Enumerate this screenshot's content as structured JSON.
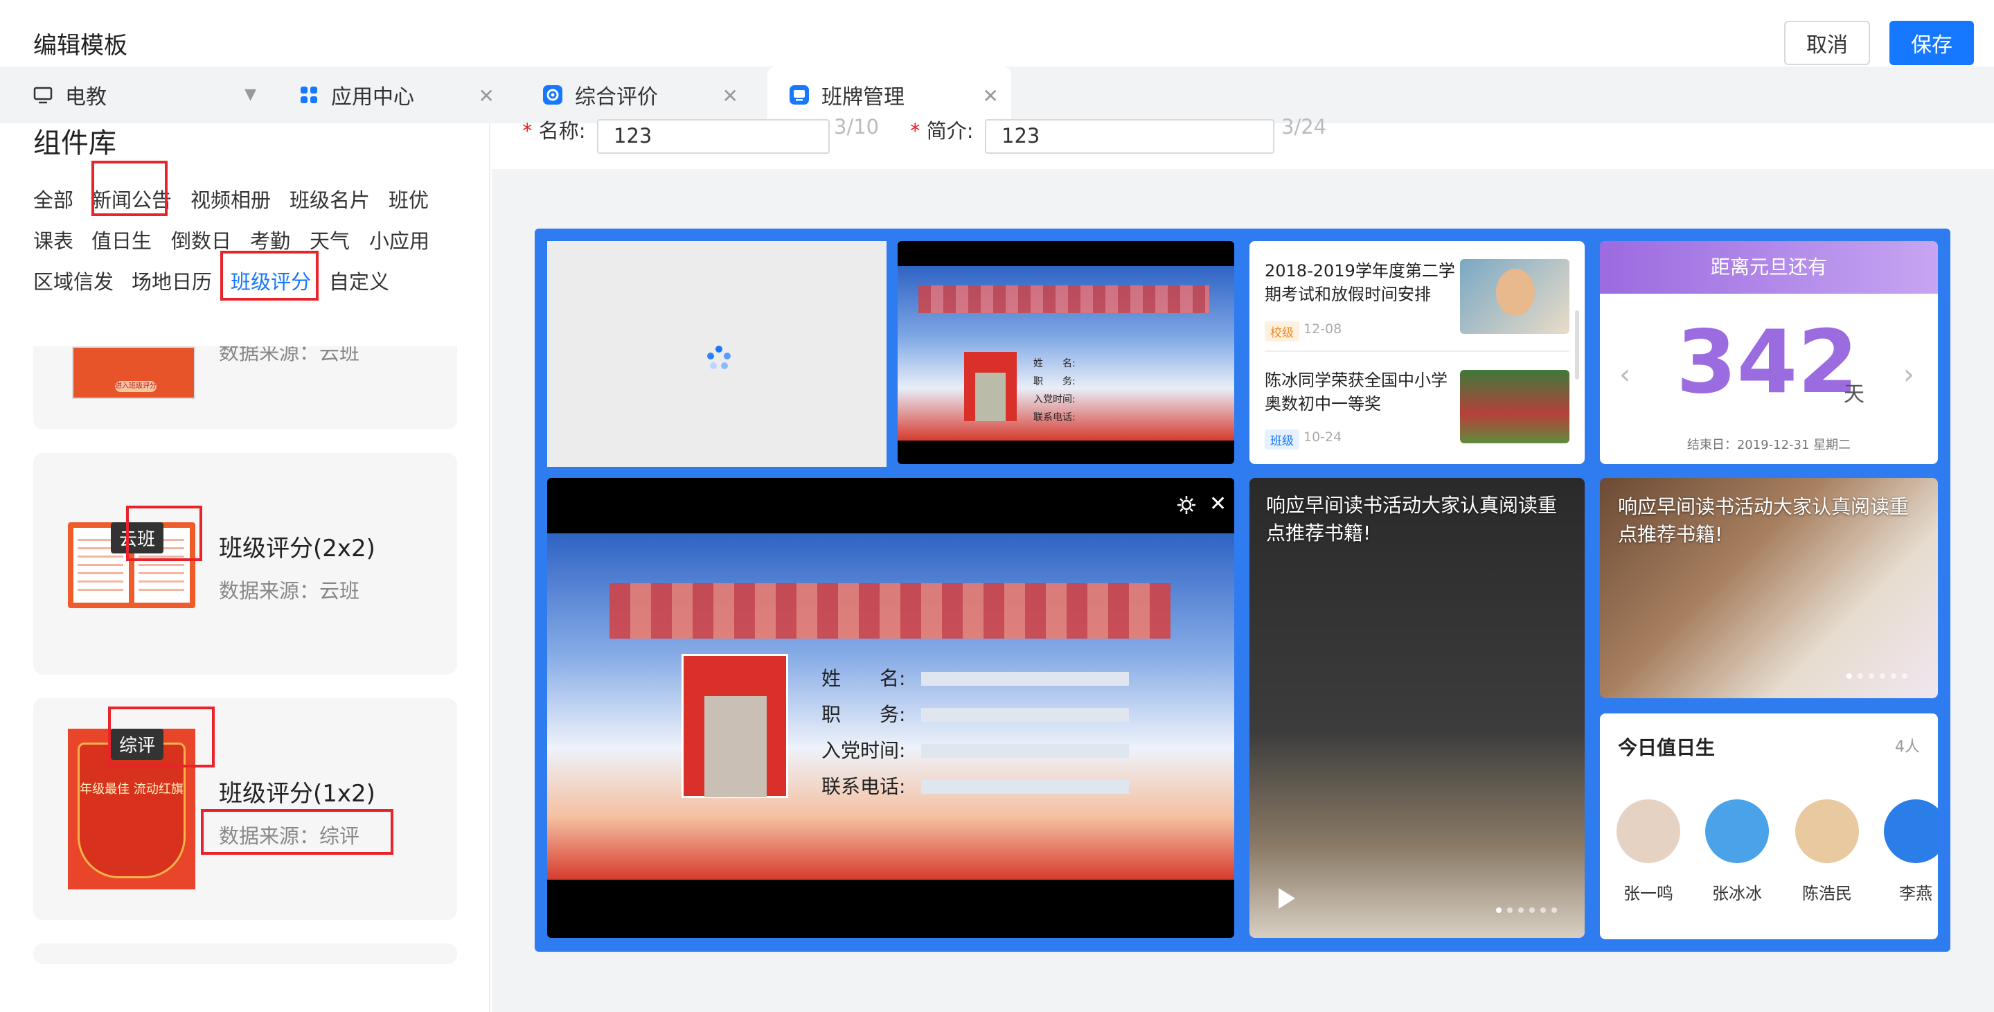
{
  "header": {
    "title": "编辑模板",
    "cancel_label": "取消",
    "save_label": "保存"
  },
  "tabs": [
    {
      "label": "电教",
      "icon": "monitor-icon"
    },
    {
      "label": "应用中心",
      "icon": "apps-grid-icon"
    },
    {
      "label": "综合评价",
      "icon": "evaluation-app-icon"
    },
    {
      "label": "班牌管理",
      "icon": "class-board-app-icon"
    }
  ],
  "library": {
    "title": "组件库",
    "categories": [
      "全部",
      "新闻公告",
      "视频相册",
      "班级名片",
      "班优",
      "课表",
      "值日生",
      "倒数日",
      "考勤",
      "天气",
      "小应用",
      "区域信发",
      "场地日历",
      "班级评分",
      "自定义"
    ],
    "selected_category": "班级评分",
    "cards": [
      {
        "name": "",
        "source": "数据来源：云班",
        "thumb_text": "进入班级评分"
      },
      {
        "name": "班级评分(2x2)",
        "source": "数据来源：云班",
        "badge": "云班"
      },
      {
        "name": "班级评分(1x2)",
        "source": "数据来源：综评",
        "badge": "综评",
        "thumb_text": "年级最佳 流动红旗"
      }
    ]
  },
  "form": {
    "name_label": "名称:",
    "name_value": "123",
    "name_count": "3/10",
    "intro_label": "简介:",
    "intro_value": "123",
    "intro_count": "3/24"
  },
  "board": {
    "news": [
      {
        "title": "2018-2019学年度第二学期考试和放假时间安排",
        "tag": "校级",
        "date": "12-08"
      },
      {
        "title": "陈冰同学荣获全国中小学奥数初中一等奖",
        "tag": "班级",
        "date": "10-24"
      }
    ],
    "countdown": {
      "header": "距离元旦还有",
      "number": "342",
      "unit": "天",
      "end_text": "结束日：2019-12-31 星期二"
    },
    "profile_small": {
      "fields": [
        "姓　　名:",
        "职　　务:",
        "入党时间:",
        "联系电话:"
      ]
    },
    "profile_large": {
      "fields": [
        "姓　　名:",
        "职　　务:",
        "入党时间:",
        "联系电话:"
      ]
    },
    "video_caption": "响应早间读书活动大家认真阅读重点推荐书籍!",
    "photo_caption": "响应早间读书活动大家认真阅读重点推荐书籍!",
    "duty": {
      "title": "今日值日生",
      "count": "4人",
      "students": [
        "张一鸣",
        "张冰冰",
        "陈浩民",
        "李燕"
      ]
    },
    "colors": {
      "accent": "#1677ff",
      "countdown": "#9b6be0",
      "board": "#2f7cf0",
      "highlight": "#e8242a"
    }
  }
}
